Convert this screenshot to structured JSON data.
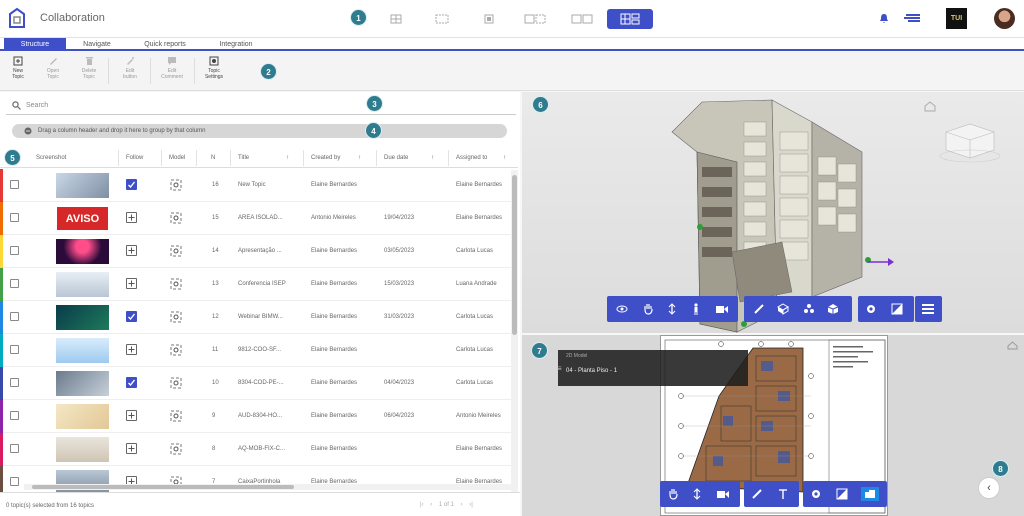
{
  "app": {
    "title": "Collaboration",
    "brand_color": "#3e4fc7"
  },
  "markers": [
    "1",
    "2",
    "3",
    "4",
    "5",
    "6",
    "7",
    "8"
  ],
  "header": {
    "user_badge": "TUI"
  },
  "tabs": [
    {
      "label": "Structure",
      "active": true
    },
    {
      "label": "Navigate"
    },
    {
      "label": "Quick reports"
    },
    {
      "label": "Integration"
    }
  ],
  "toolbar": {
    "items": [
      {
        "label_1": "New",
        "label_2": "Topic",
        "icon": "new-topic-icon",
        "enabled": true
      },
      {
        "label_1": "Open",
        "label_2": "Topic",
        "icon": "pencil-icon",
        "enabled": false
      },
      {
        "label_1": "Delete",
        "label_2": "Topic",
        "icon": "trash-icon",
        "enabled": false
      },
      {
        "label_1": "Edit",
        "label_2": "button",
        "icon": "edit-icon",
        "enabled": false
      },
      {
        "label_1": "Edit",
        "label_2": "Comment",
        "icon": "comment-icon",
        "enabled": false
      },
      {
        "label_1": "Topic",
        "label_2": "Settings",
        "icon": "gear-icon",
        "enabled": true
      }
    ]
  },
  "search": {
    "placeholder": "Search"
  },
  "group_hint": "Drag a column header and drop it here to group by that column",
  "columns": [
    "Screenshot",
    "Follow",
    "Model",
    "N",
    "Title",
    "Created by",
    "Due date",
    "Assigned to"
  ],
  "rows": [
    {
      "n": "16",
      "title": "New Topic",
      "created_by": "Elaine Bernardes",
      "due": "",
      "assigned": "Elaine Bernardes",
      "follow": true,
      "stripe": "#e53935",
      "thumb": "building"
    },
    {
      "n": "15",
      "title": "AREA ISOLAD...",
      "created_by": "Antonio Meireles",
      "due": "19/04/2023",
      "assigned": "Elaine Bernardes",
      "follow": false,
      "stripe": "#ef6c00",
      "thumb": "aviso",
      "thumb_text": "AVISO"
    },
    {
      "n": "14",
      "title": "Apresentação ...",
      "created_by": "Elaine Bernardes",
      "due": "03/05/2023",
      "assigned": "Carlota Lucas",
      "follow": false,
      "stripe": "#fdd835",
      "thumb": "stage"
    },
    {
      "n": "13",
      "title": "Conferencia ISEP",
      "created_by": "Elaine Bernardes",
      "due": "15/03/2023",
      "assigned": "Luana Andrade",
      "follow": false,
      "stripe": "#43a047",
      "thumb": "conference"
    },
    {
      "n": "12",
      "title": "Webinar BIMW...",
      "created_by": "Elaine Bernardes",
      "due": "31/03/2023",
      "assigned": "Carlota Lucas",
      "follow": true,
      "stripe": "#1e88e5",
      "thumb": "webinar"
    },
    {
      "n": "11",
      "title": "9812-COO-SF...",
      "created_by": "Elaine Bernardes",
      "due": "",
      "assigned": "Carlota Lucas",
      "follow": false,
      "stripe": "#00acc1",
      "thumb": "blue"
    },
    {
      "n": "10",
      "title": "8304-COD-PE-...",
      "created_by": "Elaine Bernardes",
      "due": "04/04/2023",
      "assigned": "Carlota Lucas",
      "follow": true,
      "stripe": "#3949ab",
      "thumb": "tablet"
    },
    {
      "n": "9",
      "title": "AUD-8304-HO...",
      "created_by": "Elaine Bernardes",
      "due": "06/04/2023",
      "assigned": "Antonio Meireles",
      "follow": false,
      "stripe": "#8e24aa",
      "thumb": "paper"
    },
    {
      "n": "8",
      "title": "AQ-MOB-FIX-C...",
      "created_by": "Elaine Bernardes",
      "due": "",
      "assigned": "Elaine Bernardes",
      "follow": false,
      "stripe": "#d81b60",
      "thumb": "panel"
    },
    {
      "n": "7",
      "title": "CaixaPortinhola",
      "created_by": "Elaine Bernardes",
      "due": "",
      "assigned": "Elaine Bernardes",
      "follow": false,
      "stripe": "#6d4c41",
      "thumb": "box"
    }
  ],
  "footer": {
    "status": "0 topic(s) selected from 16 topics",
    "page": "1 of 1"
  },
  "viewer2d": {
    "label": "2D Model",
    "value": "04 - Planta Piso - 1"
  }
}
